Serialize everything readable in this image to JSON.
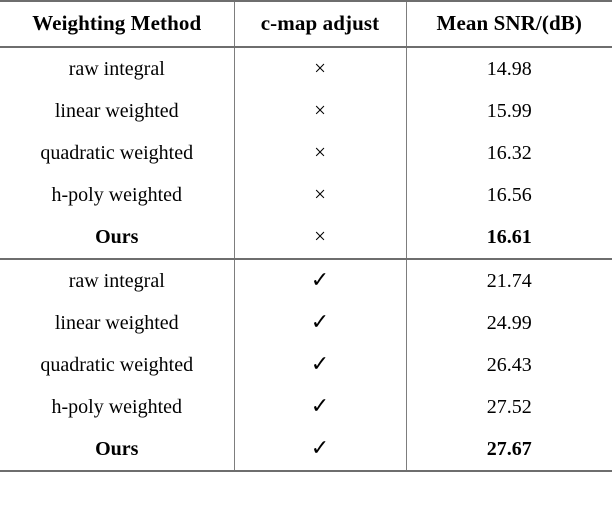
{
  "table": {
    "caption": "",
    "columns": [
      {
        "key": "method",
        "label": "Weighting Method",
        "align": "center"
      },
      {
        "key": "adjust",
        "label": "c-map adjust",
        "align": "center"
      },
      {
        "key": "snr",
        "label": "Mean SNR/(dB)",
        "align": "center"
      }
    ],
    "marks": {
      "cross": "×",
      "check": "✓"
    },
    "blocks": [
      {
        "id": "without-cmap-adjust",
        "rows": [
          {
            "method": "raw integral",
            "adjust": "×",
            "snr": "14.98",
            "highlight": false
          },
          {
            "method": "linear weighted",
            "adjust": "×",
            "snr": "15.99",
            "highlight": false
          },
          {
            "method": "quadratic weighted",
            "adjust": "×",
            "snr": "16.32",
            "highlight": false
          },
          {
            "method": "h-poly weighted",
            "adjust": "×",
            "snr": "16.56",
            "highlight": false
          },
          {
            "method": "Ours",
            "adjust": "×",
            "snr": "16.61",
            "highlight": true
          }
        ]
      },
      {
        "id": "with-cmap-adjust",
        "rows": [
          {
            "method": "raw integral",
            "adjust": "✓",
            "snr": "21.74",
            "highlight": false
          },
          {
            "method": "linear weighted",
            "adjust": "✓",
            "snr": "24.99",
            "highlight": false
          },
          {
            "method": "quadratic weighted",
            "adjust": "✓",
            "snr": "26.43",
            "highlight": false
          },
          {
            "method": "h-poly weighted",
            "adjust": "✓",
            "snr": "27.52",
            "highlight": false
          },
          {
            "method": "Ours",
            "adjust": "✓",
            "snr": "27.67",
            "highlight": true
          }
        ]
      }
    ]
  },
  "style": {
    "rule_color": "#6e6e6e",
    "divider_color": "#7d7d7d",
    "text_color": "#000000",
    "background": "#ffffff"
  }
}
